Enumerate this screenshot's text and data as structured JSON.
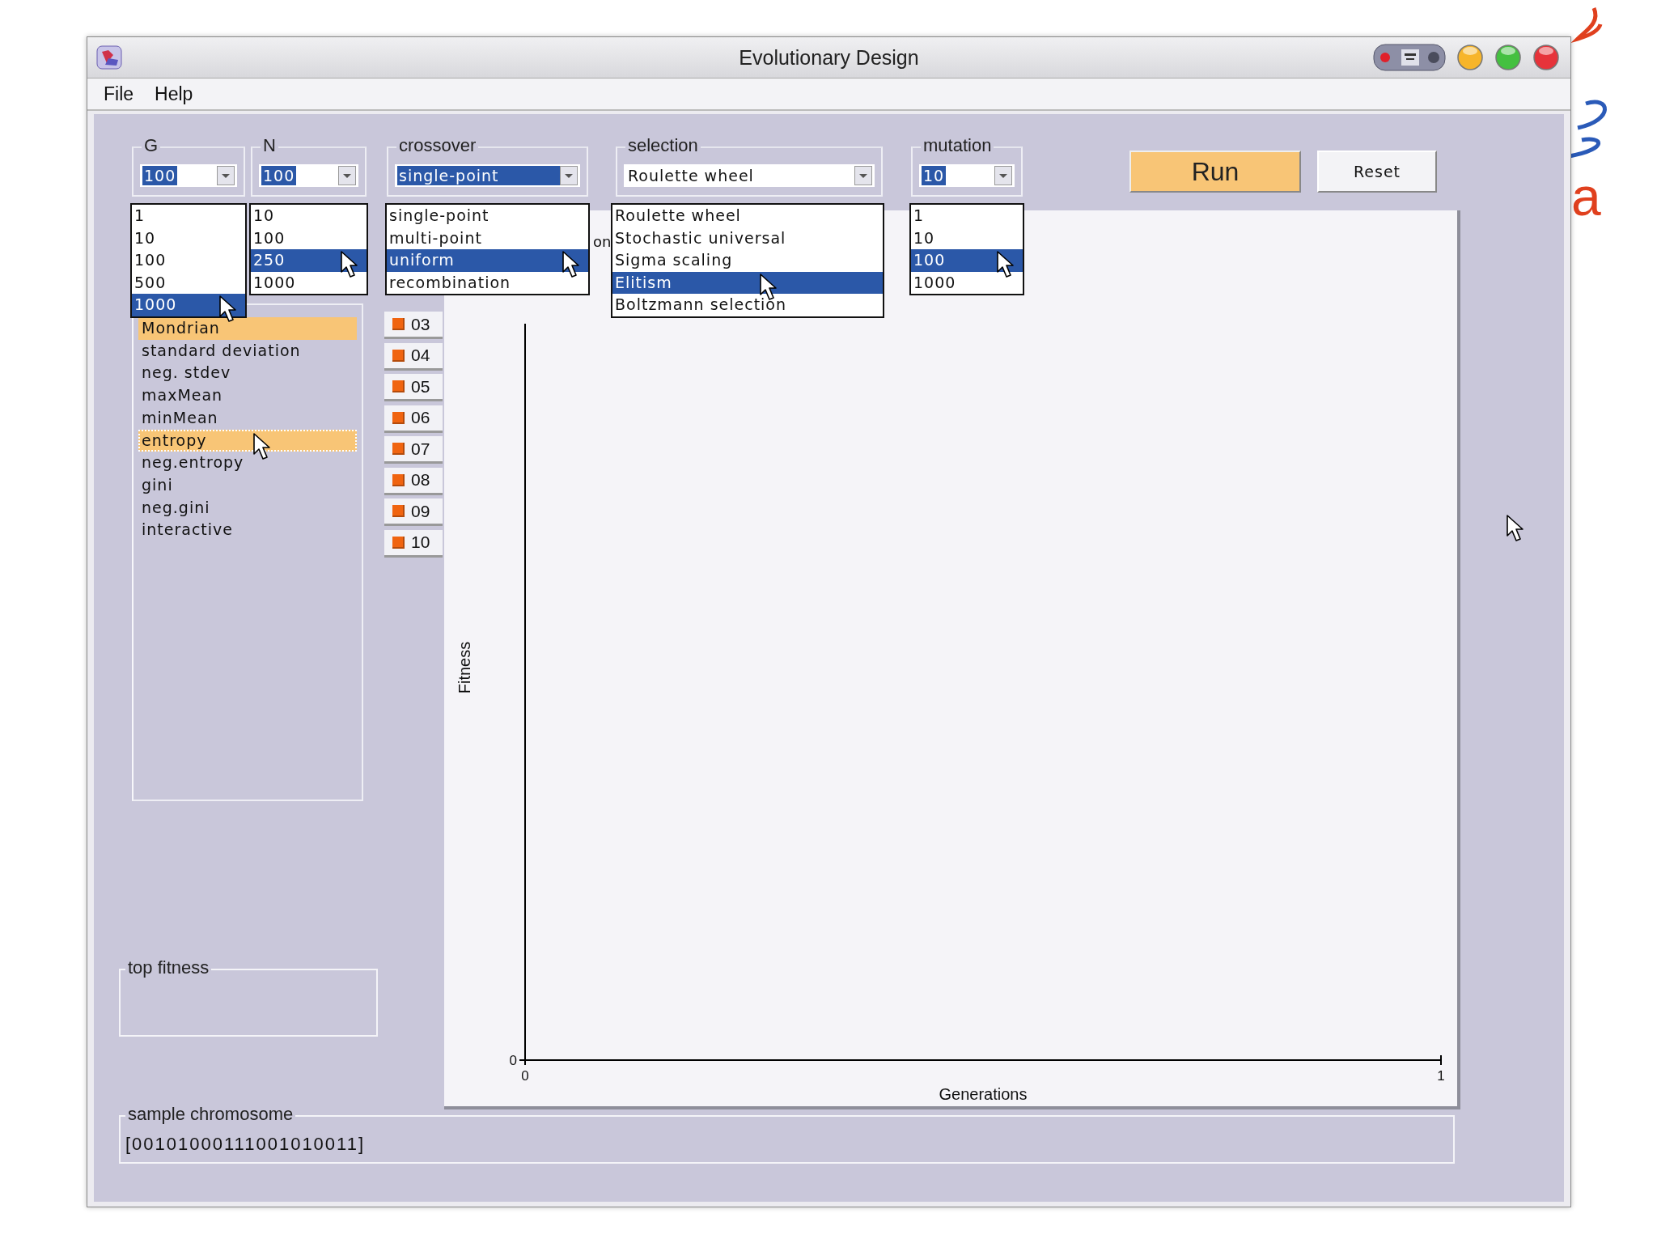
{
  "window": {
    "title": "Evolutionary Design"
  },
  "menu": [
    {
      "label": "File"
    },
    {
      "label": "Help"
    }
  ],
  "dropdowns": [
    {
      "label": "G",
      "value": "100",
      "value_highlighted": true,
      "expanded": true,
      "options": [
        {
          "label": "1",
          "highlighted": false
        },
        {
          "label": "10",
          "highlighted": false
        },
        {
          "label": "100",
          "highlighted": false
        },
        {
          "label": "500",
          "highlighted": false
        },
        {
          "label": "1000",
          "highlighted": true
        }
      ]
    },
    {
      "label": "N",
      "value": "100",
      "value_highlighted": true,
      "expanded": true,
      "options": [
        {
          "label": "10",
          "highlighted": false
        },
        {
          "label": "100",
          "highlighted": false
        },
        {
          "label": "250",
          "highlighted": true
        },
        {
          "label": "1000",
          "highlighted": false
        }
      ]
    },
    {
      "label": "crossover",
      "value": "single-point",
      "value_highlighted": true,
      "expanded": true,
      "options": [
        {
          "label": "single-point",
          "highlighted": false
        },
        {
          "label": "multi-point",
          "highlighted": false
        },
        {
          "label": "uniform",
          "highlighted": true
        },
        {
          "label": "recombination",
          "highlighted": false
        }
      ]
    },
    {
      "label": "selection",
      "value": "Roulette wheel",
      "value_highlighted": false,
      "expanded": true,
      "options": [
        {
          "label": "Roulette wheel",
          "highlighted": false
        },
        {
          "label": "Stochastic universal",
          "highlighted": false
        },
        {
          "label": "Sigma scaling",
          "highlighted": false
        },
        {
          "label": "Elitism",
          "highlighted": true
        },
        {
          "label": "Boltzmann selection",
          "highlighted": false
        }
      ]
    },
    {
      "label": "mutation",
      "value": "10",
      "value_highlighted": true,
      "expanded": true,
      "options": [
        {
          "label": "1",
          "highlighted": false
        },
        {
          "label": "10",
          "highlighted": false
        },
        {
          "label": "100",
          "highlighted": true
        },
        {
          "label": "1000",
          "highlighted": false
        }
      ]
    }
  ],
  "run_button": "Run",
  "reset_button": "Reset",
  "fitness_functions": [
    {
      "label": "Mondrian",
      "selected": true,
      "focused": false
    },
    {
      "label": "standard deviation",
      "selected": false,
      "focused": false
    },
    {
      "label": "neg. stdev",
      "selected": false,
      "focused": false
    },
    {
      "label": "maxMean",
      "selected": false,
      "focused": false
    },
    {
      "label": "minMean",
      "selected": false,
      "focused": false
    },
    {
      "label": "entropy",
      "selected": true,
      "focused": true
    },
    {
      "label": "neg.entropy",
      "selected": false,
      "focused": false
    },
    {
      "label": "gini",
      "selected": false,
      "focused": false
    },
    {
      "label": "neg.gini",
      "selected": false,
      "focused": false
    },
    {
      "label": "interactive",
      "selected": false,
      "focused": false
    }
  ],
  "series_toggles": [
    {
      "label": "03",
      "checked": true
    },
    {
      "label": "04",
      "checked": true
    },
    {
      "label": "05",
      "checked": true
    },
    {
      "label": "06",
      "checked": true
    },
    {
      "label": "07",
      "checked": true
    },
    {
      "label": "08",
      "checked": true
    },
    {
      "label": "09",
      "checked": true
    },
    {
      "label": "10",
      "checked": true
    }
  ],
  "chart": {
    "legend_fragment": "on",
    "x_axis_label": "Generations",
    "y_axis_label": "Fitness",
    "x_tick_labels": [
      "0",
      "1"
    ],
    "y_tick_label": "0"
  },
  "top_fitness": {
    "label": "top fitness"
  },
  "sample_chromosome": {
    "label": "sample chromosome",
    "value": "[00101000111001010011]"
  },
  "desktop_logo": {
    "text": "a"
  }
}
